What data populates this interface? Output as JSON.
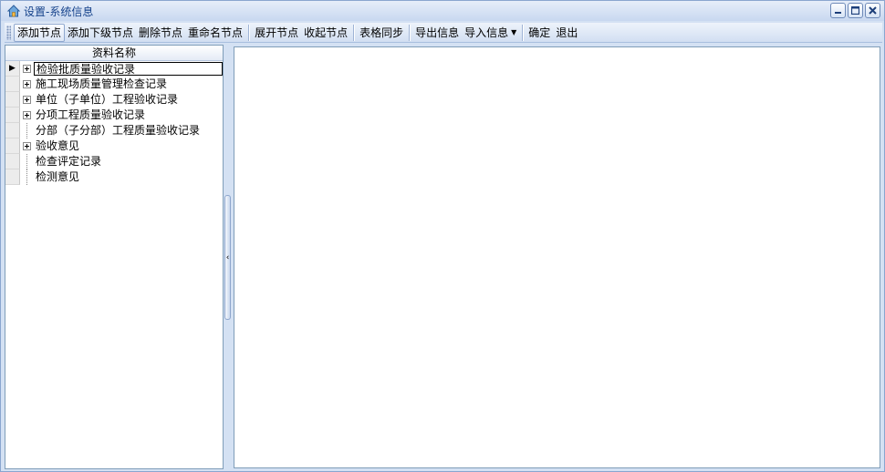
{
  "window": {
    "title": "设置-系统信息",
    "app_icon": "home-icon",
    "controls": [
      "minimize-icon",
      "maximize-icon",
      "close-icon"
    ]
  },
  "toolbar": {
    "add_node": "添加节点",
    "add_child": "添加下级节点",
    "delete_node": "删除节点",
    "rename_node": "重命名节点",
    "expand_node": "展开节点",
    "collapse_node": "收起节点",
    "table_sync": "表格同步",
    "export_info": "导出信息",
    "import_info": "导入信息",
    "confirm": "确定",
    "exit": "退出"
  },
  "tree": {
    "header": "资料名称",
    "rows": [
      {
        "label": "检验批质量验收记录",
        "expandable": true,
        "selected": true
      },
      {
        "label": "施工现场质量管理检查记录",
        "expandable": true,
        "selected": false
      },
      {
        "label": "单位（子单位）工程验收记录",
        "expandable": true,
        "selected": false
      },
      {
        "label": "分项工程质量验收记录",
        "expandable": true,
        "selected": false
      },
      {
        "label": "分部（子分部）工程质量验收记录",
        "expandable": false,
        "selected": false
      },
      {
        "label": "验收意见",
        "expandable": true,
        "selected": false
      },
      {
        "label": "检查评定记录",
        "expandable": false,
        "selected": false
      },
      {
        "label": "检测意见",
        "expandable": false,
        "selected": false
      }
    ]
  },
  "editor": {
    "value": ""
  },
  "colors": {
    "frame": "#d4e1f3",
    "border": "#7f9db9",
    "title_text": "#15428b"
  }
}
